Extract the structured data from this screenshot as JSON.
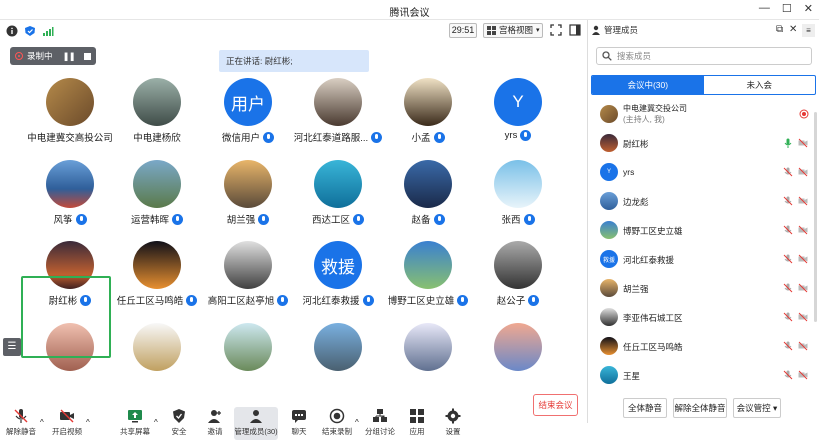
{
  "window": {
    "title": "腾讯会议"
  },
  "topbar": {
    "timer": "29:51",
    "view_mode": "宫格视图"
  },
  "recording": {
    "label": "录制中"
  },
  "speaking": {
    "text": "正在讲话: 尉红彬;"
  },
  "tiles": [
    {
      "name": "中电建冀交高投公司",
      "mic": false,
      "avatar": "photo"
    },
    {
      "name": "中电建杨欣",
      "mic": false,
      "avatar": "photo"
    },
    {
      "name": "微信用户",
      "mic": true,
      "avatar": "text",
      "avatar_text": "用户"
    },
    {
      "name": "河北红泰道路服...",
      "mic": true,
      "avatar": "photo"
    },
    {
      "name": "小孟",
      "mic": true,
      "avatar": "photo"
    },
    {
      "name": "yrs",
      "mic": true,
      "avatar": "text",
      "avatar_text": "Y"
    },
    {
      "name": "风筝",
      "mic": true,
      "avatar": "photo"
    },
    {
      "name": "运营韩晖",
      "mic": true,
      "avatar": "photo"
    },
    {
      "name": "胡兰强",
      "mic": true,
      "avatar": "photo"
    },
    {
      "name": "西达工区",
      "mic": true,
      "avatar": "photo"
    },
    {
      "name": "赵备",
      "mic": true,
      "avatar": "photo"
    },
    {
      "name": "张西",
      "mic": true,
      "avatar": "photo"
    },
    {
      "name": "尉红彬",
      "mic": true,
      "avatar": "photo"
    },
    {
      "name": "任丘工区马鸣皓",
      "mic": true,
      "avatar": "photo"
    },
    {
      "name": "高阳工区赵亭旭",
      "mic": true,
      "avatar": "photo"
    },
    {
      "name": "河北红泰救援",
      "mic": true,
      "avatar": "text",
      "avatar_text": "救援"
    },
    {
      "name": "博野工区史立雄",
      "mic": true,
      "avatar": "photo"
    },
    {
      "name": "赵公子",
      "mic": true,
      "avatar": "photo"
    },
    {
      "name": "",
      "mic": false,
      "avatar": "photo"
    },
    {
      "name": "",
      "mic": false,
      "avatar": "photo"
    },
    {
      "name": "",
      "mic": false,
      "avatar": "photo"
    },
    {
      "name": "",
      "mic": false,
      "avatar": "photo"
    },
    {
      "name": "",
      "mic": false,
      "avatar": "photo"
    },
    {
      "name": "",
      "mic": false,
      "avatar": "photo"
    }
  ],
  "toolbar": {
    "unmute": "解除静音",
    "video": "开启视频",
    "share": "共享屏幕",
    "security": "安全",
    "invite": "邀请",
    "members": "管理成员(30)",
    "chat": "聊天",
    "end_record": "结束录制",
    "breakout": "分组讨论",
    "apps": "应用",
    "settings": "设置",
    "end_meeting": "结束会议"
  },
  "side": {
    "header": "管理成员",
    "search_placeholder": "搜索成员",
    "tab_in": "会议中(30)",
    "tab_out": "未入会",
    "members": [
      {
        "name": "中电建冀交投公司",
        "sub": "(主持人, 我)",
        "avatar": "photo"
      },
      {
        "name": "尉红彬",
        "avatar": "photo"
      },
      {
        "name": "yrs",
        "avatar": "text",
        "avatar_text": "Y"
      },
      {
        "name": "边龙彪",
        "avatar": "photo"
      },
      {
        "name": "博野工区史立雄",
        "avatar": "photo"
      },
      {
        "name": "河北红泰救援",
        "avatar": "text",
        "avatar_text": "救援"
      },
      {
        "name": "胡兰强",
        "avatar": "photo"
      },
      {
        "name": "李亚伟石城工区",
        "avatar": "photo"
      },
      {
        "name": "任丘工区马鸣皓",
        "avatar": "photo"
      },
      {
        "name": "王星",
        "avatar": "photo"
      }
    ],
    "mute_all": "全体静音",
    "unmute_all": "解除全体静音",
    "control": "会议管控"
  }
}
